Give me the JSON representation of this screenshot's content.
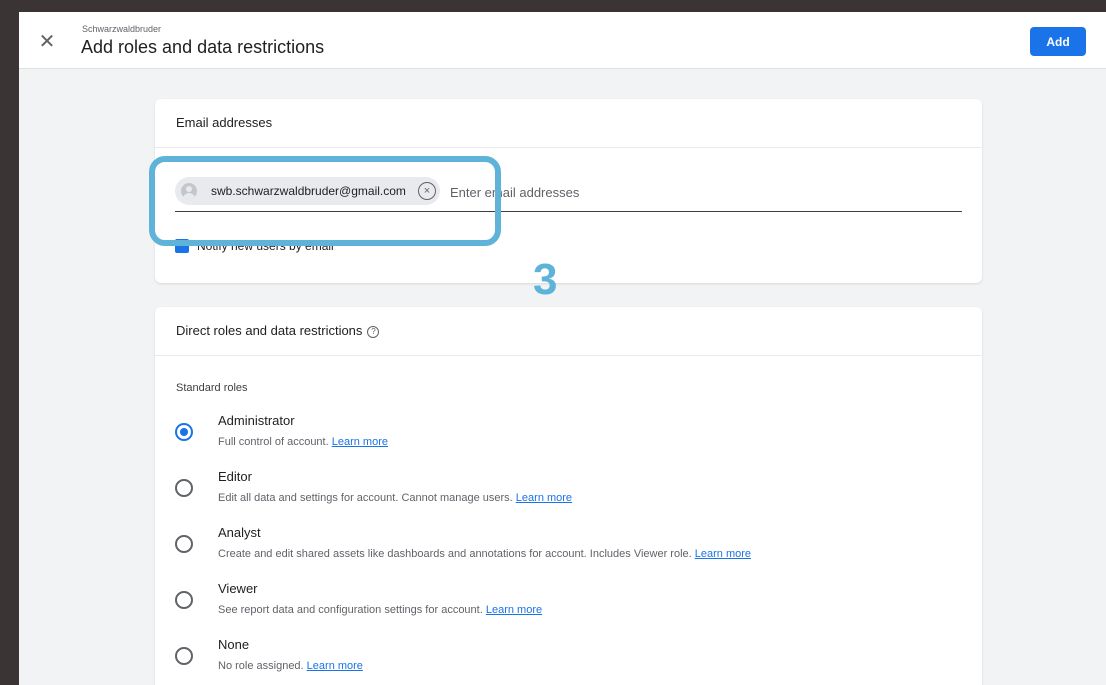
{
  "header": {
    "account_name": "Schwarzwaldbruder",
    "title": "Add roles and data restrictions",
    "add_label": "Add"
  },
  "emails": {
    "header": "Email addresses",
    "chip_email": "swb.schwarzwaldbruder@gmail.com",
    "input_placeholder": "Enter email addresses",
    "notify_label": "Notify new users by email"
  },
  "overlay": {
    "step_number": "3",
    "highlight_color": "#5fb3d9"
  },
  "roles": {
    "header": "Direct roles and data restrictions",
    "section_label": "Standard roles",
    "items": [
      {
        "name": "Administrator",
        "desc": "Full control of account.",
        "link": "Learn more",
        "selected": true
      },
      {
        "name": "Editor",
        "desc": "Edit all data and settings for account. Cannot manage users.",
        "link": "Learn more",
        "selected": false
      },
      {
        "name": "Analyst",
        "desc": "Create and edit shared assets like dashboards and annotations for account. Includes Viewer role.",
        "link": "Learn more",
        "selected": false
      },
      {
        "name": "Viewer",
        "desc": "See report data and configuration settings for account.",
        "link": "Learn more",
        "selected": false
      },
      {
        "name": "None",
        "desc": "No role assigned.",
        "link": "Learn more",
        "selected": false
      }
    ]
  },
  "icons": {
    "close": "close-icon",
    "help": "help-circle-icon",
    "avatar": "person-avatar-icon",
    "remove": "cancel-circle-icon"
  },
  "colors": {
    "accent": "#1a73e8",
    "background": "#f1f3f4",
    "frame": "#3b3435"
  }
}
